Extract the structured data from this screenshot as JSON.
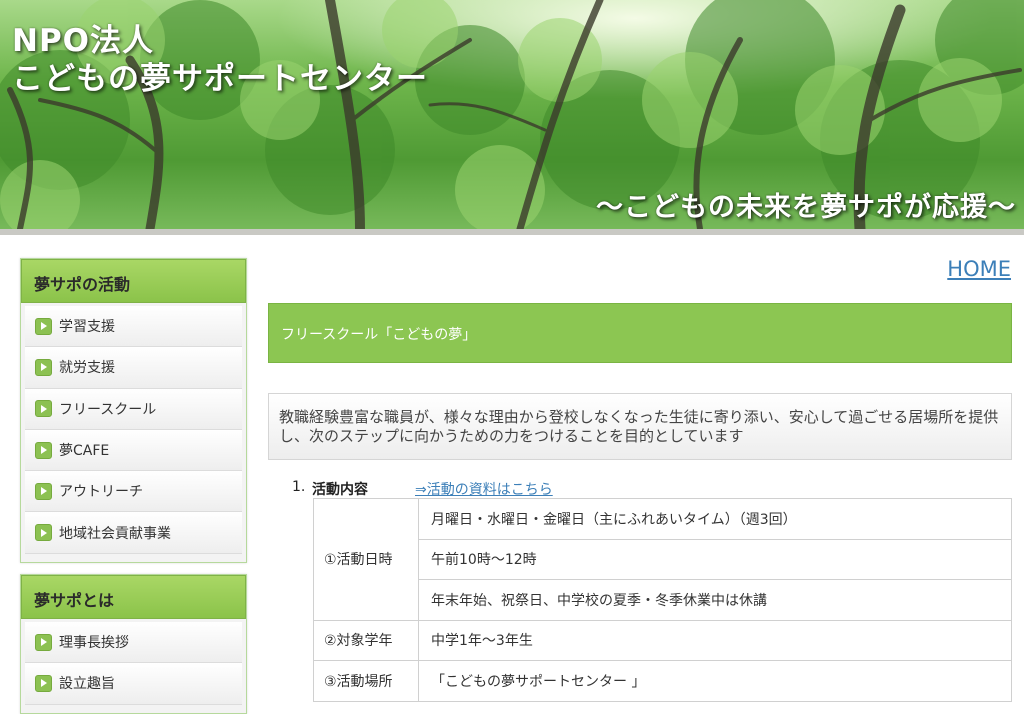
{
  "header": {
    "title_line1": "NPO法人",
    "title_line2": "こどもの夢サポートセンター",
    "tagline": "～こどもの未来を夢サポが応援～"
  },
  "sidebar": {
    "sections": [
      {
        "heading": "夢サポの活動",
        "items": [
          {
            "label": "学習支援",
            "icon": "arrow-right-icon"
          },
          {
            "label": "就労支援",
            "icon": "arrow-right-icon"
          },
          {
            "label": "フリースクール",
            "icon": "arrow-right-icon"
          },
          {
            "label": "夢CAFE",
            "icon": "arrow-right-icon"
          },
          {
            "label": "アウトリーチ",
            "icon": "arrow-right-icon"
          },
          {
            "label": "地域社会貢献事業",
            "icon": "arrow-right-icon"
          }
        ]
      },
      {
        "heading": "夢サポとは",
        "items": [
          {
            "label": "理事長挨拶",
            "icon": "arrow-right-icon"
          },
          {
            "label": "設立趣旨",
            "icon": "arrow-right-icon"
          }
        ]
      }
    ]
  },
  "main": {
    "home_link": "HOME",
    "page_heading": "フリースクール「こどもの夢」",
    "description": "教職経験豊富な職員が、様々な理由から登校しなくなった生徒に寄り添い、安心して過ごせる居場所を提供し、次のステップに向かうための力をつけることを目的としています",
    "section": {
      "number": "1.",
      "label": "活動内容",
      "link": "⇒活動の資料はこちら"
    },
    "table": {
      "rows": [
        {
          "key": "①活動日時",
          "values": [
            "月曜日・水曜日・金曜日（主にふれあいタイム）（週3回）",
            "午前10時～12時",
            "年末年始、祝祭日、中学校の夏季・冬季休業中は休講"
          ]
        },
        {
          "key": "②対象学年",
          "values": [
            "中学1年～3年生"
          ]
        },
        {
          "key": "③活動場所",
          "values": [
            "「こどもの夢サポートセンター 」"
          ]
        }
      ]
    }
  },
  "colors": {
    "accent_green": "#8cc652",
    "link_blue": "#3c7fb8"
  }
}
